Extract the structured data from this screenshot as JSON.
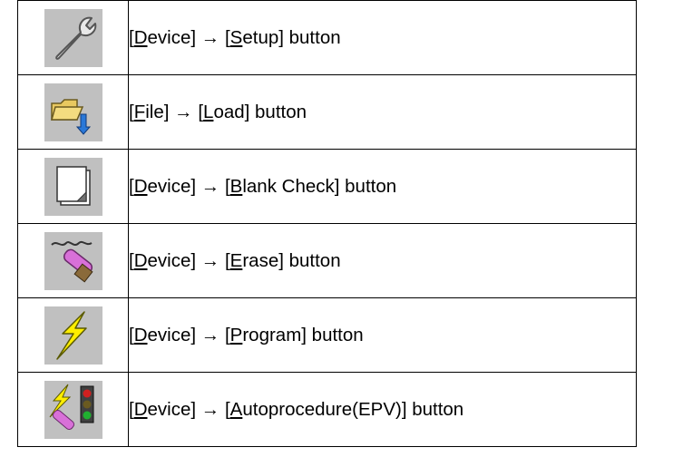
{
  "rows": [
    {
      "icon": "wrench-icon",
      "segs": [
        "[",
        "D",
        "evice] → [",
        "S",
        "etup] button"
      ]
    },
    {
      "icon": "folder-load-icon",
      "segs": [
        "[",
        "F",
        "ile] → [",
        "L",
        "oad] button"
      ]
    },
    {
      "icon": "blank-pages-icon",
      "segs": [
        "[",
        "D",
        "evice] → [",
        "B",
        "lank Check] button"
      ]
    },
    {
      "icon": "eraser-icon",
      "segs": [
        "[",
        "D",
        "evice] → [",
        "E",
        "rase] button"
      ]
    },
    {
      "icon": "lightning-icon",
      "segs": [
        "[",
        "D",
        "evice] → [",
        "P",
        "rogram] button"
      ]
    },
    {
      "icon": "autoprocedure-icon",
      "segs": [
        "[",
        "D",
        "evice] → [",
        "A",
        "utoprocedure(EPV)] button"
      ]
    }
  ],
  "colors": {
    "icon_bg": "#c0c0c0",
    "border": "#000000",
    "bolt": "#ffee00",
    "folder": "#e8c860",
    "arrow": "#2a78d8",
    "signal_red": "#d02020",
    "signal_green": "#20b030"
  }
}
